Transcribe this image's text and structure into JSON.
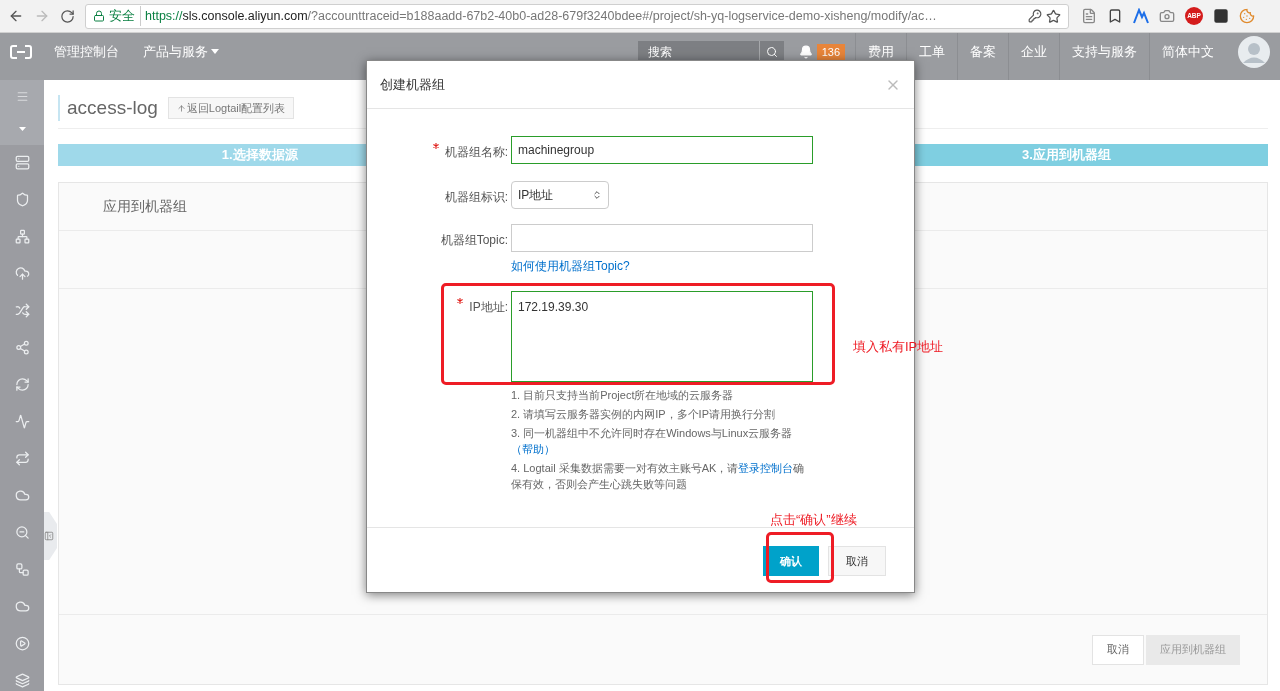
{
  "browser": {
    "secure_label": "安全",
    "url": {
      "scheme": "https://",
      "host": "sls.console.aliyun.com",
      "rest": "/?accounttraceid=b188aadd-67b2-40b0-ad28-679f3240bdee#/project/sh-yq-logservice-demo-xisheng/modify/ac…"
    },
    "adblock_label": "ABP"
  },
  "nav": {
    "home": "管理控制台",
    "products": "产品与服务",
    "search": {
      "placeholder": "搜索"
    },
    "notification_count": "136",
    "links": [
      "费用",
      "工单",
      "备案",
      "企业",
      "支持与服务",
      "简体中文"
    ]
  },
  "page": {
    "title": "access-log",
    "back_button": "返回Logtail配置列表",
    "steps": [
      {
        "label": "1.选择数据源",
        "selected": false
      },
      {
        "label": "3.应用到机器组",
        "selected": true
      }
    ],
    "card_title": "应用到机器组",
    "footer_buttons": [
      {
        "label": "取消",
        "disabled": false
      },
      {
        "label": "应用到机器组",
        "disabled": true
      }
    ]
  },
  "dialog": {
    "title": "创建机器组",
    "fields": [
      {
        "kind": "text",
        "label": "机器组名称:",
        "required": true,
        "valid": true,
        "value": "machinegroup"
      },
      {
        "kind": "select",
        "label": "机器组标识:",
        "required": false,
        "value": "IP地址"
      },
      {
        "kind": "text",
        "label": "机器组Topic:",
        "required": false,
        "valid": false,
        "help_link": "如何使用机器组Topic?"
      },
      {
        "kind": "textarea",
        "label": "IP地址:",
        "required": true,
        "valid": true,
        "value": "172.19.39.30"
      }
    ],
    "notes": [
      [
        {
          "kind": "text",
          "text": "1. 目前只支持当前Project所在地域的云服务器"
        }
      ],
      [
        {
          "kind": "text",
          "text": "2. 请填写云服务器实例的内网IP，多个IP请用换行分割"
        }
      ],
      [
        {
          "kind": "text",
          "text": "3. 同一机器组中不允许同时存在Windows与Linux云服务器"
        },
        {
          "kind": "link",
          "text": "（帮助）"
        }
      ],
      [
        {
          "kind": "text",
          "text": "4. Logtail 采集数据需要一对有效主账号AK，请"
        },
        {
          "kind": "link",
          "text": "登录控制台"
        },
        {
          "kind": "text",
          "text": "确保有效，否则会产生心跳失败等问题"
        }
      ]
    ],
    "buttons": [
      {
        "label": "确认",
        "primary": true
      },
      {
        "label": "取消",
        "primary": false
      }
    ]
  },
  "annotations": [
    {
      "text": "填入私有IP地址"
    },
    {
      "text": "点击“确认”继续"
    }
  ]
}
